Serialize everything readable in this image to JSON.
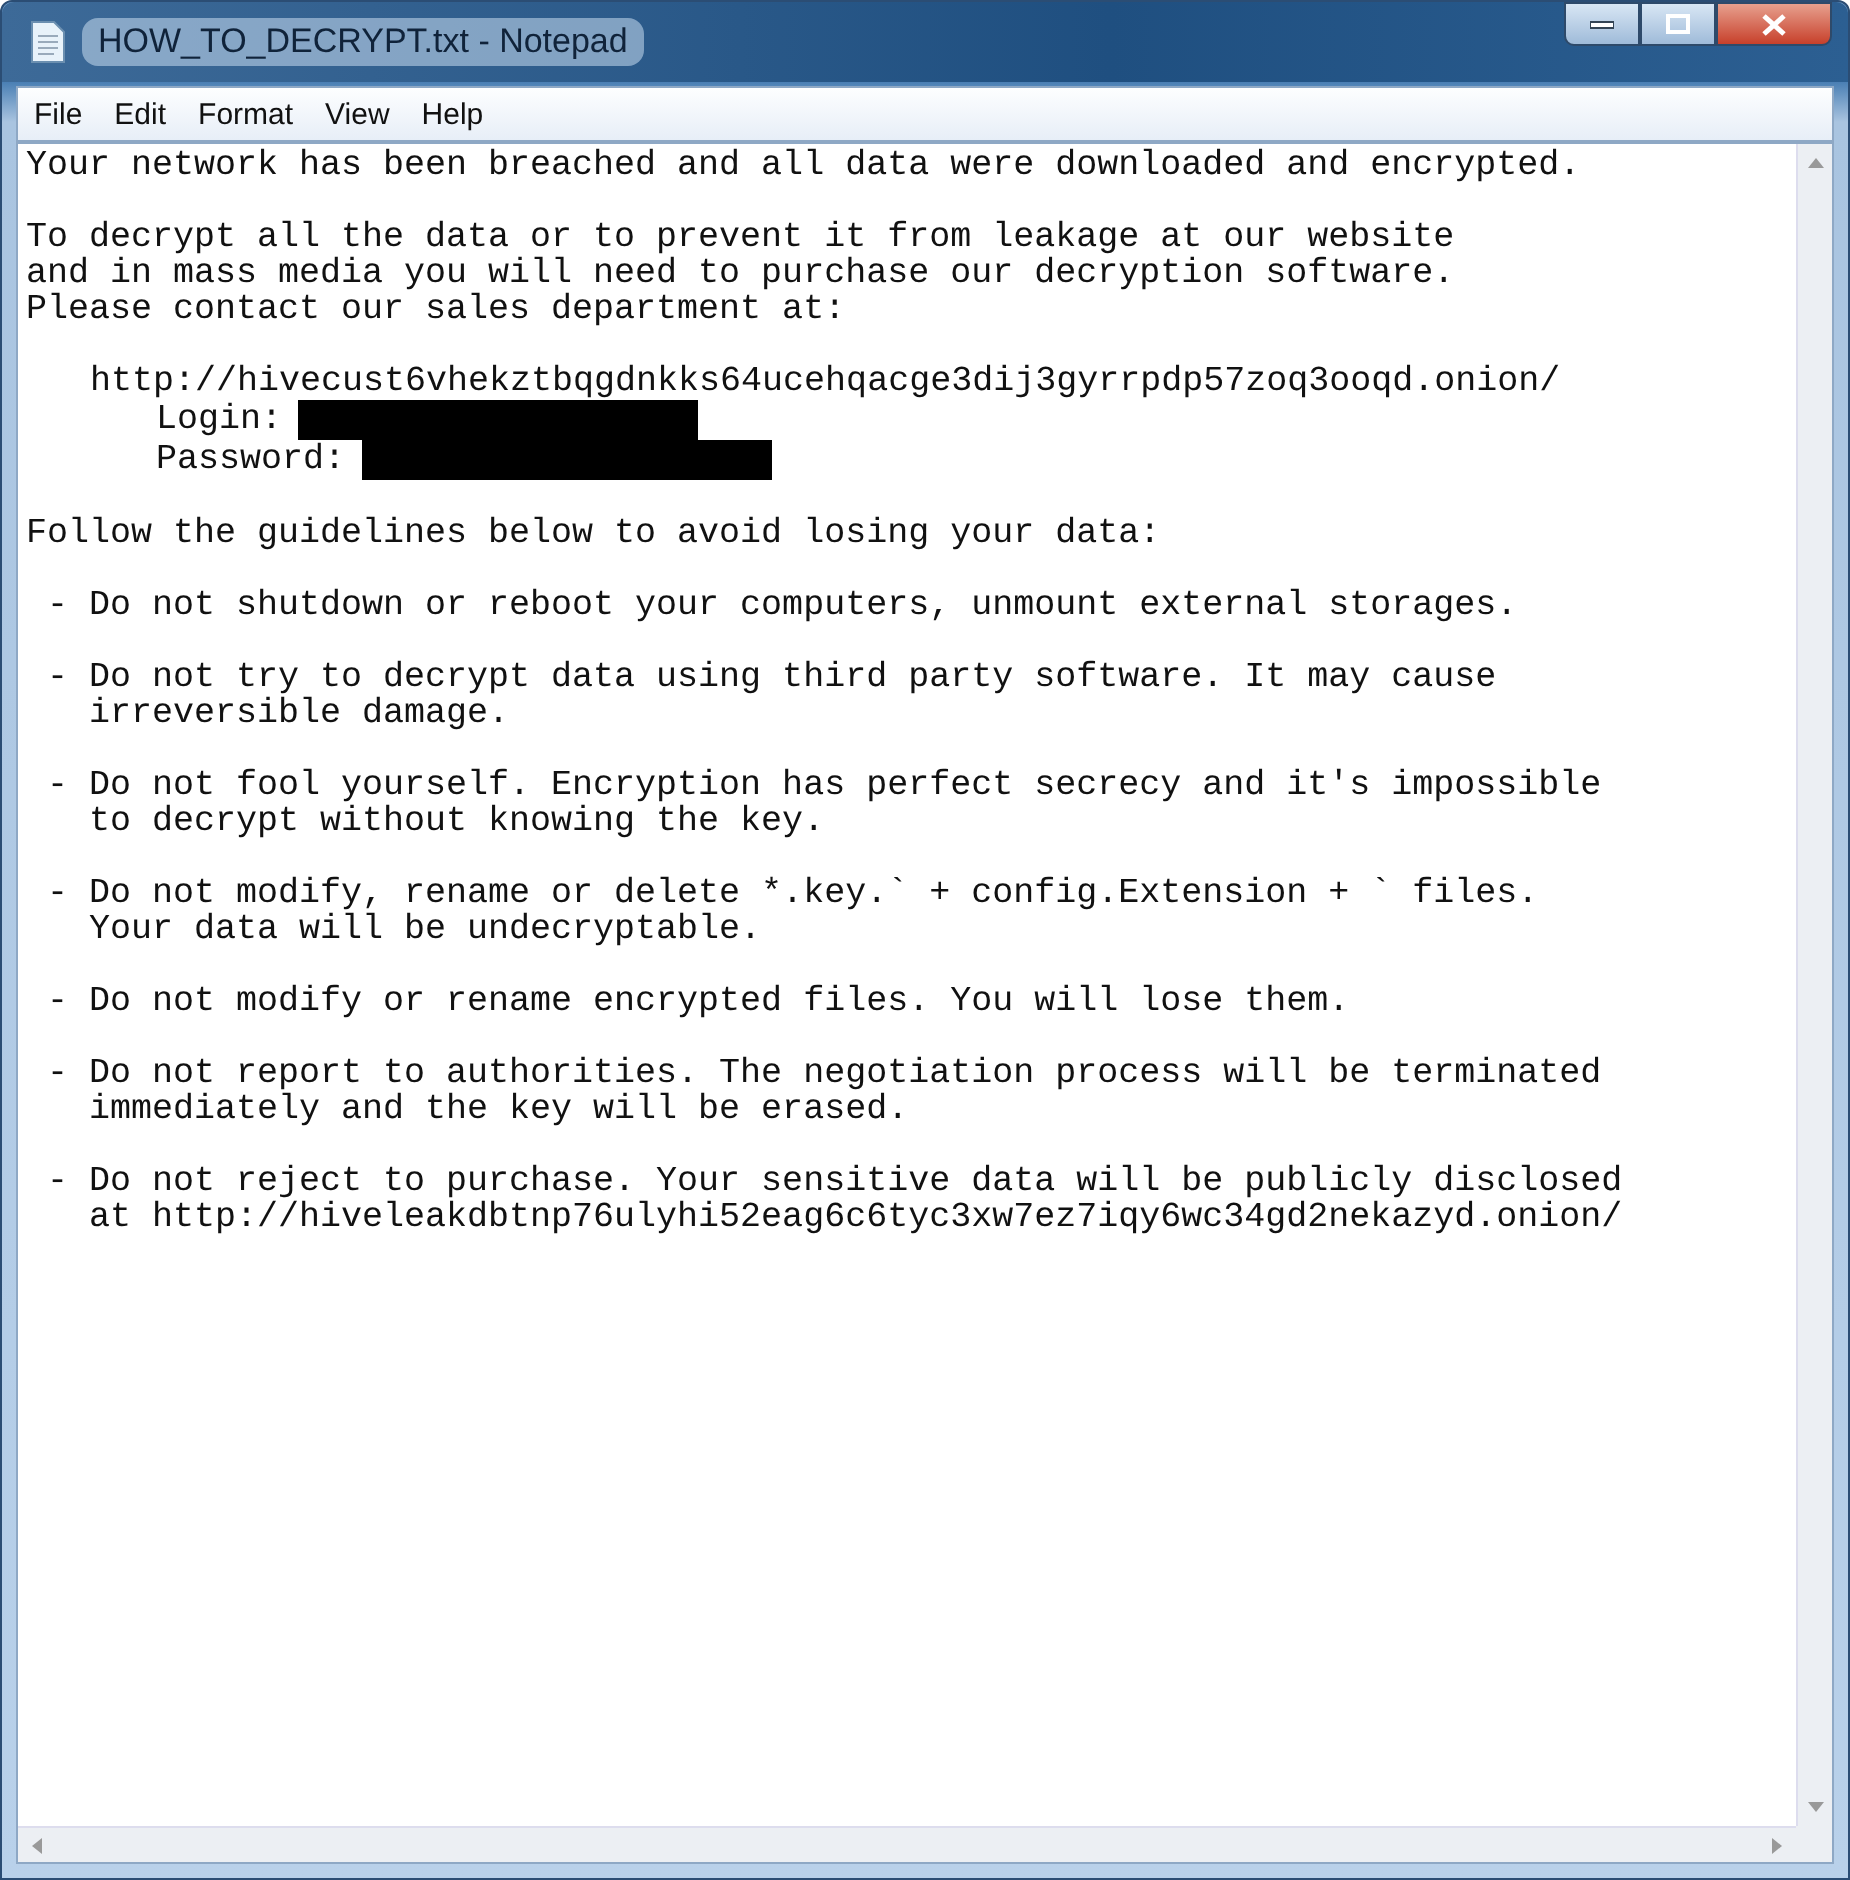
{
  "window": {
    "title": "HOW_TO_DECRYPT.txt - Notepad"
  },
  "menu": [
    "File",
    "Edit",
    "Format",
    "View",
    "Help"
  ],
  "document": [
    {
      "kind": "text",
      "text": "Your network has been breached and all data were downloaded and encrypted."
    },
    {
      "kind": "text",
      "text": "To decrypt all the data or to prevent it from leakage at our website\nand in mass media you will need to purchase our decryption software.\nPlease contact our sales department at:"
    },
    {
      "kind": "contact",
      "url": "http://hivecust6vhekztbqgdnkks64ucehqacge3dij3gyrrpdp57zoq3ooqd.onion/",
      "credentials": [
        {
          "label": "Login:",
          "redacted": true
        },
        {
          "label": "Password:",
          "redacted": true
        }
      ]
    },
    {
      "kind": "text",
      "text": "Follow the guidelines below to avoid losing your data:"
    },
    {
      "kind": "text",
      "text": " - Do not shutdown or reboot your computers, unmount external storages."
    },
    {
      "kind": "text",
      "text": " - Do not try to decrypt data using third party software. It may cause\n   irreversible damage."
    },
    {
      "kind": "text",
      "text": " - Do not fool yourself. Encryption has perfect secrecy and it's impossible\n   to decrypt without knowing the key."
    },
    {
      "kind": "text",
      "text": " - Do not modify, rename or delete *.key.` + config.Extension + ` files.\n   Your data will be undecryptable."
    },
    {
      "kind": "text",
      "text": " - Do not modify or rename encrypted files. You will lose them."
    },
    {
      "kind": "text",
      "text": " - Do not report to authorities. The negotiation process will be terminated\n   immediately and the key will be erased."
    },
    {
      "kind": "text",
      "text": " - Do not reject to purchase. Your sensitive data will be publicly disclosed\n   at http://hiveleakdbtnp76ulyhi52eag6c6tyc3xw7ez7iqy6wc34gd2nekazyd.onion/"
    }
  ]
}
